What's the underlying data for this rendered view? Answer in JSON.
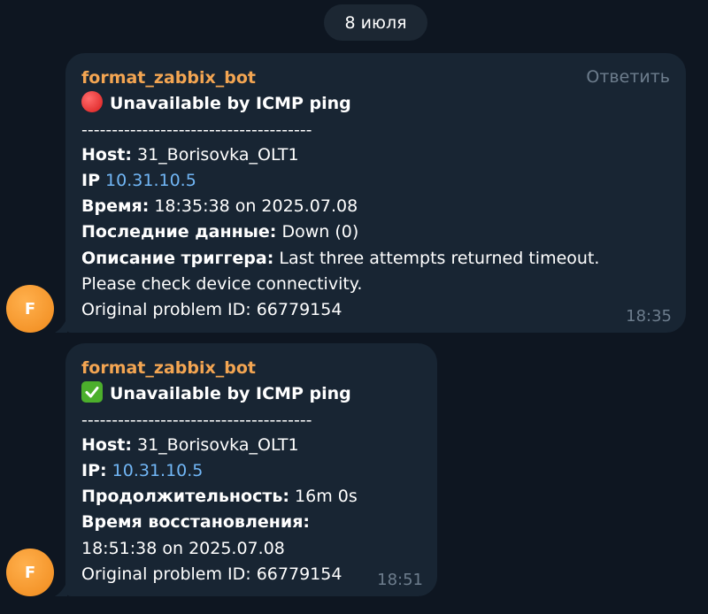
{
  "date_separator": "8 июля",
  "messages": [
    {
      "sender": "format_zabbix_bot",
      "avatar_letter": "F",
      "reply_label": "Ответить",
      "status_icon": "red-circle-emoji",
      "title": "Unavailable by ICMP ping",
      "divider": "--------------------------------------",
      "host_label": "Host:",
      "host_value": " 31_Borisovka_OLT1",
      "ip_label": "IP",
      "ip_value": "10.31.10.5",
      "time_label": "Время:",
      "time_value": " 18:35:38 on 2025.07.08",
      "last_data_label": "Последние данные:",
      "last_data_value": " Down (0)",
      "trigger_label": "Описание триггера:",
      "trigger_value": " Last three attempts returned timeout.",
      "trigger_value_2": "Please check device connectivity.",
      "problem_id": "Original problem ID: 66779154",
      "timestamp": "18:35"
    },
    {
      "sender": "format_zabbix_bot",
      "avatar_letter": "F",
      "status_icon": "green-check-emoji",
      "title": "Unavailable by ICMP ping",
      "divider": "--------------------------------------",
      "host_label": "Host:",
      "host_value": " 31_Borisovka_OLT1",
      "ip_label": "IP:",
      "ip_value": "10.31.10.5",
      "duration_label": "Продолжительность:",
      "duration_value": " 16m 0s",
      "recovery_label": "Время восстановления:",
      "recovery_value": "18:51:38 on 2025.07.08",
      "problem_id": "Original problem ID: 66779154",
      "timestamp": "18:51"
    }
  ],
  "colors": {
    "background": "#0e1621",
    "bubble": "#182533",
    "sender": "#f3a552",
    "link": "#71b6f5",
    "muted": "#6d7d8d",
    "avatar": "#f59a2d"
  }
}
